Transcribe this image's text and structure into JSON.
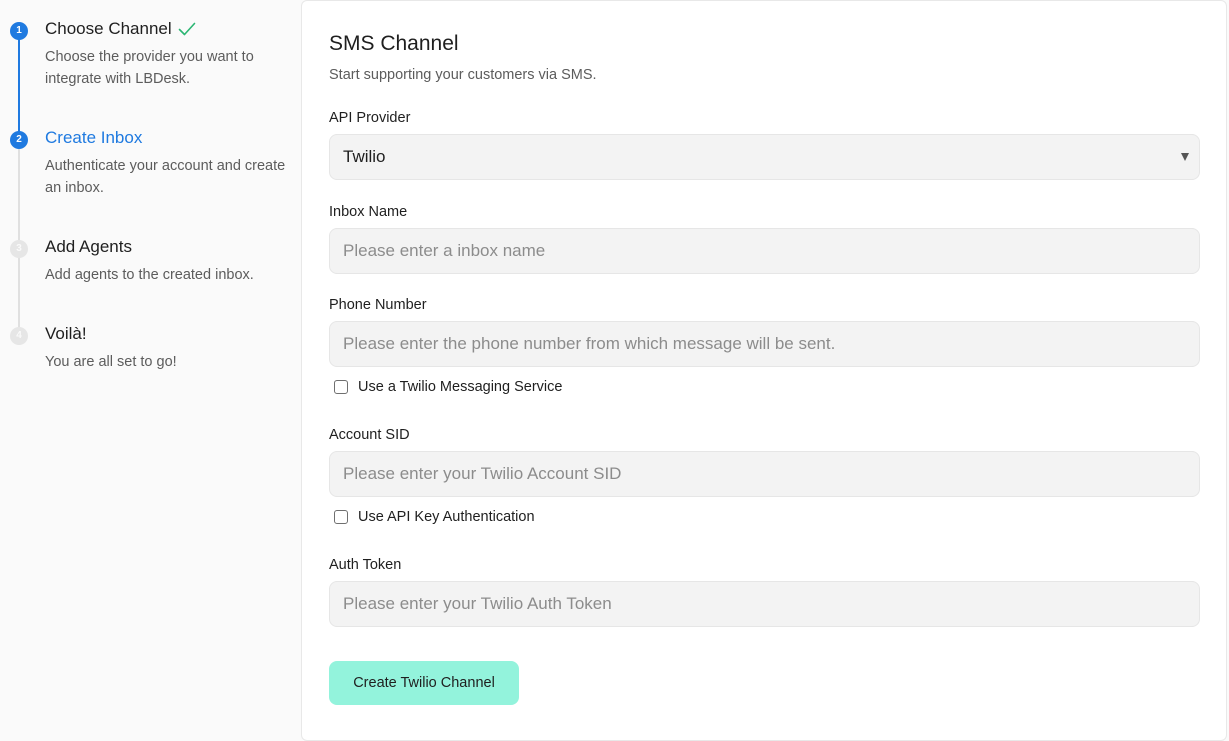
{
  "steps": [
    {
      "number": "1",
      "title": "Choose Channel",
      "description": "Choose the provider you want to integrate with LBDesk.",
      "state": "done"
    },
    {
      "number": "2",
      "title": "Create Inbox",
      "description": "Authenticate your account and create an inbox.",
      "state": "current"
    },
    {
      "number": "3",
      "title": "Add Agents",
      "description": "Add agents to the created inbox.",
      "state": "pending"
    },
    {
      "number": "4",
      "title": "Voilà!",
      "description": "You are all set to go!",
      "state": "pending"
    }
  ],
  "form": {
    "title": "SMS Channel",
    "subtitle": "Start supporting your customers via SMS.",
    "api_provider": {
      "label": "API Provider",
      "value": "Twilio"
    },
    "inbox_name": {
      "label": "Inbox Name",
      "value": "",
      "placeholder": "Please enter a inbox name"
    },
    "phone_number": {
      "label": "Phone Number",
      "value": "",
      "placeholder": "Please enter the phone number from which message will be sent."
    },
    "messaging_service_checkbox": {
      "label": "Use a Twilio Messaging Service",
      "checked": false
    },
    "account_sid": {
      "label": "Account SID",
      "value": "",
      "placeholder": "Please enter your Twilio Account SID"
    },
    "api_key_checkbox": {
      "label": "Use API Key Authentication",
      "checked": false
    },
    "auth_token": {
      "label": "Auth Token",
      "value": "",
      "placeholder": "Please enter your Twilio Auth Token"
    },
    "submit_label": "Create Twilio Channel"
  },
  "colors": {
    "accent": "#1f7ae0",
    "check": "#2bb673",
    "button": "#93f3dc"
  },
  "icons": {
    "step_done": "check-icon",
    "select": "chevron-down-icon"
  }
}
